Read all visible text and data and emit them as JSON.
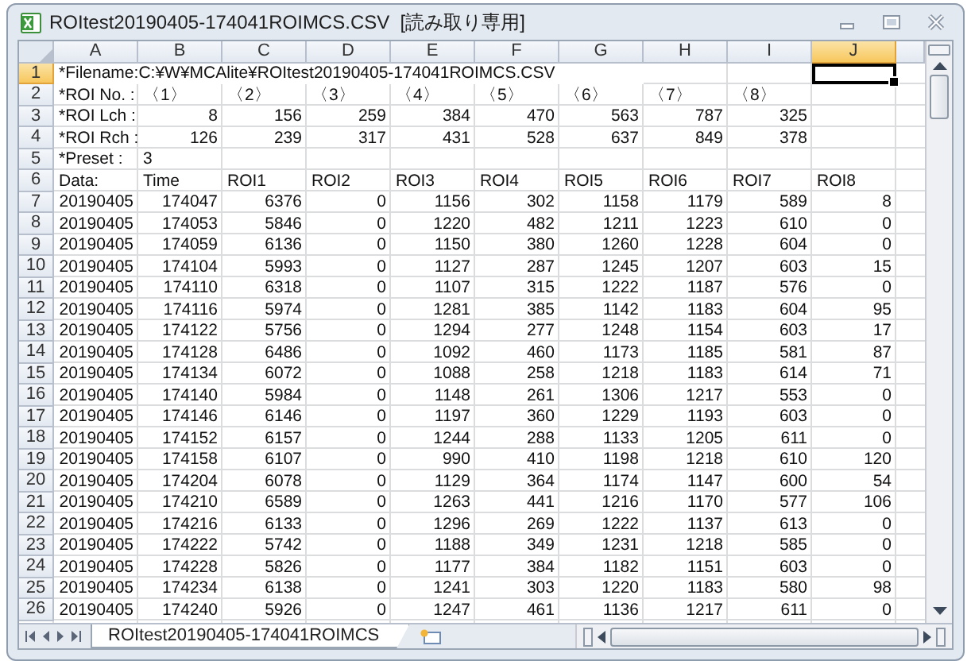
{
  "window": {
    "title": "ROItest20190405-174041ROIMCS.CSV  [読み取り専用]"
  },
  "columns": [
    {
      "label": "A",
      "selected": false
    },
    {
      "label": "B",
      "selected": false
    },
    {
      "label": "C",
      "selected": false
    },
    {
      "label": "D",
      "selected": false
    },
    {
      "label": "E",
      "selected": false
    },
    {
      "label": "F",
      "selected": false
    },
    {
      "label": "G",
      "selected": false
    },
    {
      "label": "H",
      "selected": false
    },
    {
      "label": "I",
      "selected": false
    },
    {
      "label": "J",
      "selected": true
    }
  ],
  "rows": [
    {
      "number": "1",
      "selected": true,
      "kind": "text",
      "cells": [
        "*Filename:C:¥W¥MCAlite¥ROItest20190405-174041ROIMCS.CSV",
        null,
        null,
        null,
        null,
        null,
        null,
        null,
        null,
        null
      ]
    },
    {
      "number": "2",
      "selected": false,
      "kind": "text",
      "cells": [
        "*ROI No. :",
        "〈1〉",
        "〈2〉",
        "〈3〉",
        "〈4〉",
        "〈5〉",
        "〈6〉",
        "〈7〉",
        "〈8〉",
        null
      ]
    },
    {
      "number": "3",
      "selected": false,
      "kind": "label",
      "cells": [
        "*ROI Lch :",
        "8",
        "156",
        "259",
        "384",
        "470",
        "563",
        "787",
        "325",
        null
      ]
    },
    {
      "number": "4",
      "selected": false,
      "kind": "label",
      "cells": [
        "*ROI Rch :",
        "126",
        "239",
        "317",
        "431",
        "528",
        "637",
        "849",
        "378",
        null
      ]
    },
    {
      "number": "5",
      "selected": false,
      "kind": "text",
      "cells": [
        "*Preset  :",
        "3",
        null,
        null,
        null,
        null,
        null,
        null,
        null,
        null
      ]
    },
    {
      "number": "6",
      "selected": false,
      "kind": "text",
      "cells": [
        "Data:",
        "Time",
        "ROI1",
        "ROI2",
        "ROI3",
        "ROI4",
        "ROI5",
        "ROI6",
        "ROI7",
        "ROI8"
      ]
    },
    {
      "number": "7",
      "selected": false,
      "kind": "data",
      "cells": [
        "20190405",
        "174047",
        "6376",
        "0",
        "1156",
        "302",
        "1158",
        "1179",
        "589",
        "8"
      ]
    },
    {
      "number": "8",
      "selected": false,
      "kind": "data",
      "cells": [
        "20190405",
        "174053",
        "5846",
        "0",
        "1220",
        "482",
        "1211",
        "1223",
        "610",
        "0"
      ]
    },
    {
      "number": "9",
      "selected": false,
      "kind": "data",
      "cells": [
        "20190405",
        "174059",
        "6136",
        "0",
        "1150",
        "380",
        "1260",
        "1228",
        "604",
        "0"
      ]
    },
    {
      "number": "10",
      "selected": false,
      "kind": "data",
      "cells": [
        "20190405",
        "174104",
        "5993",
        "0",
        "1127",
        "287",
        "1245",
        "1207",
        "603",
        "15"
      ]
    },
    {
      "number": "11",
      "selected": false,
      "kind": "data",
      "cells": [
        "20190405",
        "174110",
        "6318",
        "0",
        "1107",
        "315",
        "1222",
        "1187",
        "576",
        "0"
      ]
    },
    {
      "number": "12",
      "selected": false,
      "kind": "data",
      "cells": [
        "20190405",
        "174116",
        "5974",
        "0",
        "1281",
        "385",
        "1142",
        "1183",
        "604",
        "95"
      ]
    },
    {
      "number": "13",
      "selected": false,
      "kind": "data",
      "cells": [
        "20190405",
        "174122",
        "5756",
        "0",
        "1294",
        "277",
        "1248",
        "1154",
        "603",
        "17"
      ]
    },
    {
      "number": "14",
      "selected": false,
      "kind": "data",
      "cells": [
        "20190405",
        "174128",
        "6486",
        "0",
        "1092",
        "460",
        "1173",
        "1185",
        "581",
        "87"
      ]
    },
    {
      "number": "15",
      "selected": false,
      "kind": "data",
      "cells": [
        "20190405",
        "174134",
        "6072",
        "0",
        "1088",
        "258",
        "1218",
        "1183",
        "614",
        "71"
      ]
    },
    {
      "number": "16",
      "selected": false,
      "kind": "data",
      "cells": [
        "20190405",
        "174140",
        "5984",
        "0",
        "1148",
        "261",
        "1306",
        "1217",
        "553",
        "0"
      ]
    },
    {
      "number": "17",
      "selected": false,
      "kind": "data",
      "cells": [
        "20190405",
        "174146",
        "6146",
        "0",
        "1197",
        "360",
        "1229",
        "1193",
        "603",
        "0"
      ]
    },
    {
      "number": "18",
      "selected": false,
      "kind": "data",
      "cells": [
        "20190405",
        "174152",
        "6157",
        "0",
        "1244",
        "288",
        "1133",
        "1205",
        "611",
        "0"
      ]
    },
    {
      "number": "19",
      "selected": false,
      "kind": "data",
      "cells": [
        "20190405",
        "174158",
        "6107",
        "0",
        "990",
        "410",
        "1198",
        "1218",
        "610",
        "120"
      ]
    },
    {
      "number": "20",
      "selected": false,
      "kind": "data",
      "cells": [
        "20190405",
        "174204",
        "6078",
        "0",
        "1129",
        "364",
        "1174",
        "1147",
        "600",
        "54"
      ]
    },
    {
      "number": "21",
      "selected": false,
      "kind": "data",
      "cells": [
        "20190405",
        "174210",
        "6589",
        "0",
        "1263",
        "441",
        "1216",
        "1170",
        "577",
        "106"
      ]
    },
    {
      "number": "22",
      "selected": false,
      "kind": "data",
      "cells": [
        "20190405",
        "174216",
        "6133",
        "0",
        "1296",
        "269",
        "1222",
        "1137",
        "613",
        "0"
      ]
    },
    {
      "number": "23",
      "selected": false,
      "kind": "data",
      "cells": [
        "20190405",
        "174222",
        "5742",
        "0",
        "1188",
        "349",
        "1231",
        "1218",
        "585",
        "0"
      ]
    },
    {
      "number": "24",
      "selected": false,
      "kind": "data",
      "cells": [
        "20190405",
        "174228",
        "5826",
        "0",
        "1177",
        "384",
        "1182",
        "1151",
        "603",
        "0"
      ]
    },
    {
      "number": "25",
      "selected": false,
      "kind": "data",
      "cells": [
        "20190405",
        "174234",
        "6138",
        "0",
        "1241",
        "303",
        "1220",
        "1183",
        "580",
        "98"
      ]
    },
    {
      "number": "26",
      "selected": false,
      "kind": "data",
      "cells": [
        "20190405",
        "174240",
        "5926",
        "0",
        "1247",
        "461",
        "1136",
        "1217",
        "611",
        "0"
      ]
    }
  ],
  "sheet_tabs": [
    {
      "label": "ROItest20190405-174041ROIMCS",
      "selected": true
    }
  ]
}
